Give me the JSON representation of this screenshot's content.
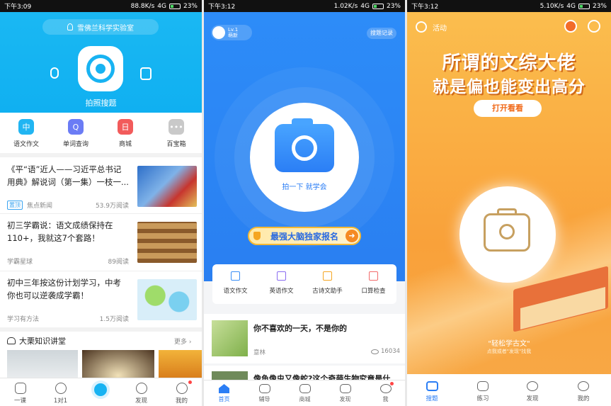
{
  "screen1": {
    "status": {
      "time": "下午3:09",
      "speed": "88.8K/s",
      "net": "4G",
      "battery": "23%"
    },
    "lab_label": "雪佛兰科学实验室",
    "camera_label": "拍照搜题",
    "quick": [
      {
        "label": "语文作文",
        "icon": "中",
        "color": "#21b5f2"
      },
      {
        "label": "单词查询",
        "icon": "Q",
        "color": "#6b7cf5"
      },
      {
        "label": "商城",
        "icon": "日",
        "color": "#f25b5b"
      },
      {
        "label": "百宝箱",
        "icon": "•••",
        "color": "#c9c9c9"
      }
    ],
    "news": [
      {
        "title": "《平“语”近人——习近平总书记用典》解说词（第一集）一枝一...",
        "tag": "置顶",
        "source": "焦点新闻",
        "reads": "53.9万阅读"
      },
      {
        "title": "初三学霸说：语文成绩保持在110+，我就这7个套路！",
        "tag": "",
        "source": "学霸星球",
        "reads": "89阅读"
      },
      {
        "title": "初中三年按这份计划学习，中考你也可以逆袭成学霸！",
        "tag": "",
        "source": "学习有方法",
        "reads": "1.5万阅读"
      }
    ],
    "section_title": "大栗知识讲堂",
    "section_more": "更多",
    "tabs": [
      "一课",
      "1对1",
      "",
      "发现",
      "我的"
    ]
  },
  "screen2": {
    "status": {
      "time": "下午3:12",
      "speed": "1.02K/s",
      "net": "4G",
      "battery": "23%"
    },
    "level": "Lv.1",
    "level_sub": "萌新",
    "history": "搜题记录",
    "camera_label": "拍一下 就学会",
    "banner": "最强大脑独家报名",
    "quick": [
      {
        "label": "语文作文",
        "color": "#3a8ef5"
      },
      {
        "label": "英语作文",
        "color": "#8a6cf0"
      },
      {
        "label": "古诗文助手",
        "color": "#f5a623"
      },
      {
        "label": "口算检查",
        "color": "#f26b6b"
      }
    ],
    "feed": {
      "title": "你不喜欢的一天，不是你的",
      "author": "意林",
      "views": "16034",
      "next_title": "像鱼像虫又像蛇?这个奇葩生物究竟是什"
    },
    "tabs": [
      "首页",
      "辅导",
      "商城",
      "发现",
      "我"
    ]
  },
  "screen3": {
    "status": {
      "time": "下午3:12",
      "speed": "5.10K/s",
      "net": "4G",
      "battery": "23%"
    },
    "activity": "活动",
    "headline1": "所谓的文综大佬",
    "headline2": "就是偏也能变出高分",
    "open_button": "打开看看",
    "slogan": "\"轻松学古文\"",
    "hint": "点我或者\"发现\"找我",
    "tabs": [
      "搜题",
      "练习",
      "发现",
      "我的"
    ]
  }
}
